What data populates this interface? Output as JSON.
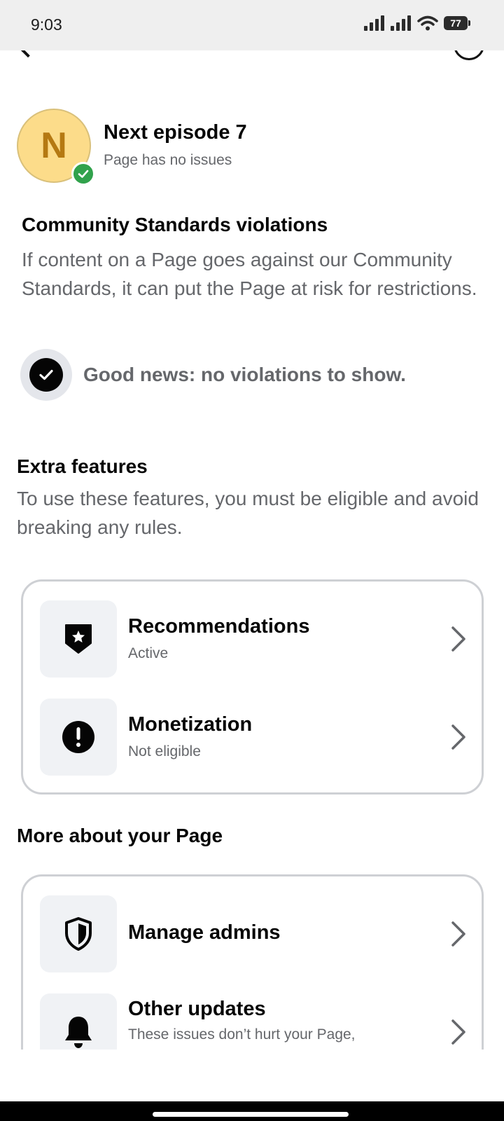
{
  "status_bar": {
    "time": "9:03",
    "battery_level": "77"
  },
  "profile": {
    "avatar_letter": "N",
    "page_name": "Next episode 7",
    "page_status": "Page has no issues"
  },
  "community_standards": {
    "title": "Community Standards violations",
    "description": "If content on a Page goes against our Community Standards, it can put the Page at risk for restrictions.",
    "good_news": "Good news: no violations to show."
  },
  "extra_features": {
    "title": "Extra features",
    "description": "To use these features, you must be eligible and avoid breaking any rules.",
    "items": [
      {
        "icon": "star-badge-icon",
        "title": "Recommendations",
        "subtitle": "Active"
      },
      {
        "icon": "exclamation-icon",
        "title": "Monetization",
        "subtitle": "Not eligible"
      }
    ]
  },
  "more_about": {
    "title": "More about your Page",
    "items": [
      {
        "icon": "shield-icon",
        "title": "Manage admins"
      },
      {
        "icon": "bell-icon",
        "title": "Other updates",
        "subtitle": "These issues don’t hurt your Page,"
      }
    ]
  },
  "colors": {
    "accent_green": "#31a24c",
    "avatar_bg": "#fcdc8a",
    "avatar_letter": "#b57912",
    "secondary_text": "#65676b"
  }
}
